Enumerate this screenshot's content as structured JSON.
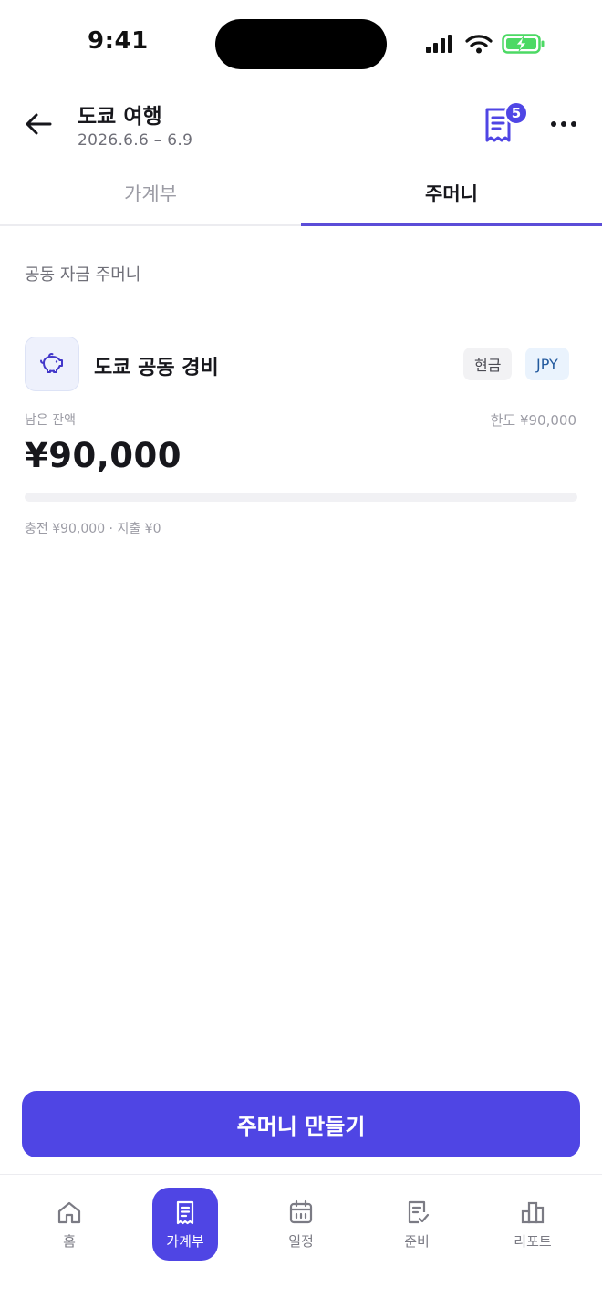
{
  "status_bar": {
    "time": "9:41"
  },
  "header": {
    "title": "도쿄 여행",
    "dates": "2026.6.6 – 6.9",
    "receipt_badge": "5"
  },
  "tabs": [
    {
      "label": "가계부",
      "active": false
    },
    {
      "label": "주머니",
      "active": true
    }
  ],
  "section_title": "공동 자금 주머니",
  "pocket": {
    "icon": "piggy-bank-icon",
    "name": "도쿄 공동 경비",
    "payment_tag": "현금",
    "currency_tag": "JPY",
    "remaining_label": "남은 잔액",
    "limit_label": "한도 ¥90,000",
    "balance": "¥90,000",
    "spent_fraction": 0,
    "summary": "충전 ¥90,000 · 지출 ¥0"
  },
  "cta_label": "주머니 만들기",
  "bottom_nav": [
    {
      "label": "홈",
      "icon": "home-icon",
      "active": false
    },
    {
      "label": "가계부",
      "icon": "receipt-icon",
      "active": true
    },
    {
      "label": "일정",
      "icon": "calendar-icon",
      "active": false
    },
    {
      "label": "준비",
      "icon": "checklist-icon",
      "active": false
    },
    {
      "label": "리포트",
      "icon": "bar-chart-icon",
      "active": false
    }
  ],
  "colors": {
    "accent": "#4f45e4",
    "tab_indicator": "#5b4dd8",
    "battery_green": "#4cd964"
  }
}
